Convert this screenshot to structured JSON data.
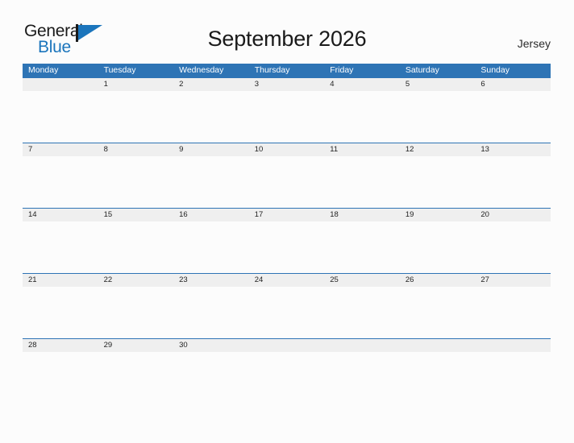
{
  "brand": {
    "name_part1": "General",
    "name_part2": "Blue",
    "logo_icon": "flag-triangle-icon",
    "colors": {
      "blue": "#1b75bc",
      "dark": "#1a1a1a"
    }
  },
  "header": {
    "title": "September 2026",
    "region": "Jersey"
  },
  "theme": {
    "header_blue": "#2e74b5",
    "date_band_gray": "#efefef",
    "page_background": "#fcfcfc",
    "text_dark": "#1f1f1f",
    "header_text": "#ffffff"
  },
  "calendar": {
    "month": "September",
    "year": "2026",
    "weekday_headers": [
      "Monday",
      "Tuesday",
      "Wednesday",
      "Thursday",
      "Friday",
      "Saturday",
      "Sunday"
    ],
    "weeks": [
      [
        "",
        "1",
        "2",
        "3",
        "4",
        "5",
        "6"
      ],
      [
        "7",
        "8",
        "9",
        "10",
        "11",
        "12",
        "13"
      ],
      [
        "14",
        "15",
        "16",
        "17",
        "18",
        "19",
        "20"
      ],
      [
        "21",
        "22",
        "23",
        "24",
        "25",
        "26",
        "27"
      ],
      [
        "28",
        "29",
        "30",
        "",
        "",
        "",
        ""
      ]
    ]
  }
}
